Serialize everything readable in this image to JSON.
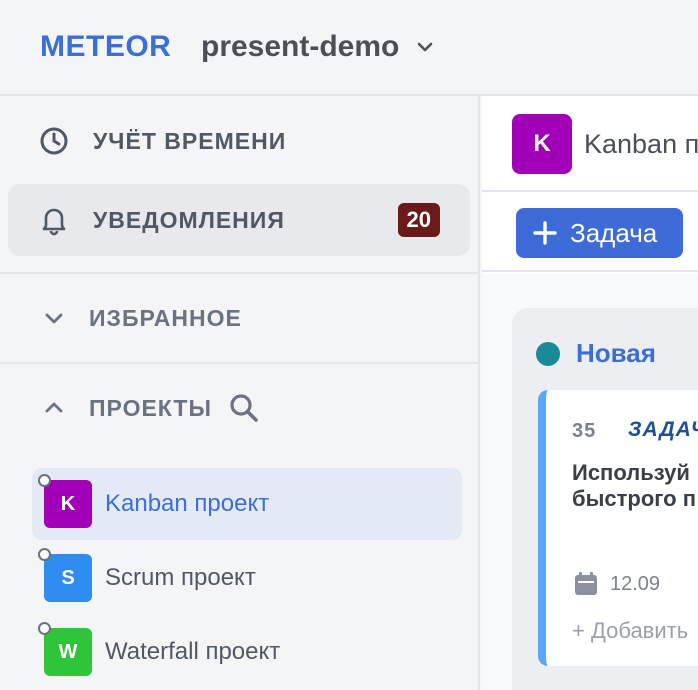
{
  "header": {
    "brand": "METEOR",
    "workspace": "present-demo"
  },
  "sidebar": {
    "time_tracking": "УЧЁТ ВРЕМЕНИ",
    "notifications": "УВЕДОМЛЕНИЯ",
    "notifications_count": "20",
    "favorites": "ИЗБРАННОЕ",
    "projects_label": "ПРОЕКТЫ",
    "projects": [
      {
        "letter": "K",
        "name": "Kanban проект",
        "color": "#a100b8"
      },
      {
        "letter": "S",
        "name": "Scrum проект",
        "color": "#2f8cf0"
      },
      {
        "letter": "W",
        "name": "Waterfall проект",
        "color": "#2fc53a"
      }
    ]
  },
  "main": {
    "avatar_letter": "K",
    "title": "Kanban проект",
    "add_task": "Задача",
    "column": {
      "title": "Новая",
      "card": {
        "number": "35",
        "type": "ЗАДАЧА",
        "text": "Используй\nбыстрого п",
        "date": "12.09",
        "add": "+ Добавить"
      }
    }
  },
  "colors": {
    "brand": "#3b6fd6",
    "badge": "#6b1a1a",
    "button": "#3d6bd8",
    "status_new": "#1a8a9a",
    "card_accent": "#5aa7f5"
  }
}
